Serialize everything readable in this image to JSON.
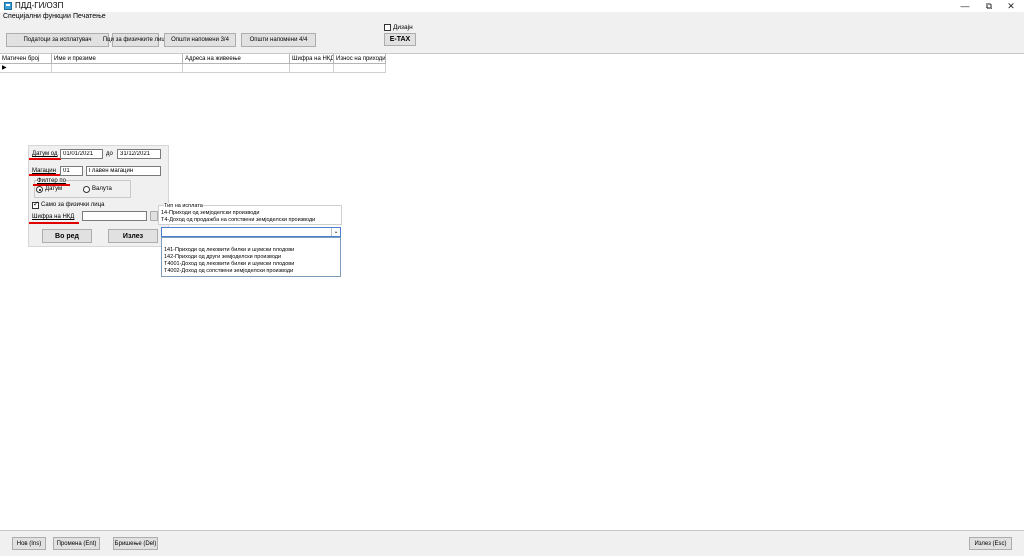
{
  "window": {
    "title": "ПДД-ГИ/ОЗП",
    "minimize": "—",
    "restore": "⧉",
    "close": "✕"
  },
  "menu": {
    "items": [
      "Специјални функции",
      "Печатење"
    ]
  },
  "toolbar": {
    "buttons": [
      "Податоци за исплатувач",
      "Пци за физичките лица",
      "Општи напомени 3/4",
      "Општи напомени 4/4"
    ],
    "design_checkbox": {
      "label": "Дизајн",
      "checked": false
    },
    "etax_label": "E-TAX"
  },
  "grid": {
    "columns": [
      "Матичен број",
      "Име и презиме",
      "Адреса на живеење",
      "Шифра на НКД",
      "Износ на приходи"
    ],
    "current_row_marker": "▶"
  },
  "filter": {
    "date_from_label": "Датум од",
    "date_from": "01/01/2021",
    "date_to_label": "до",
    "date_to": "31/12/2021",
    "warehouse_label": "Магацин",
    "warehouse_code": "01",
    "warehouse_name": "Главен магацин",
    "filter_by_label": "Филтер по",
    "filter_options": [
      "Датум",
      "Валута"
    ],
    "filter_selected": "Датум",
    "only_physical_label": "Само за физички лица",
    "only_physical_checked": true,
    "nkd_label": "Шифра на НКД",
    "nkd_value": "",
    "ok_label": "Во ред",
    "exit_label": "Излез"
  },
  "payment_type": {
    "title": "Тип на исплата",
    "header_lines": [
      "14-Приходи од земјоделски  производи",
      "Т4-Доход од продажба на сопствени земјоделски производи"
    ],
    "selected_value": "",
    "options": [
      "141-Приходи од лековити билки и шумски  плодови",
      "142-Приходи од други земјоделски производи",
      "Т4001-Доход од лековити билки и шумски плодови",
      "Т4002-Доход од сопствени земјоделски производи"
    ]
  },
  "statusbar": {
    "buttons": [
      "Нов (Ins)",
      "Промена (Ent)",
      "Бришење (Del)"
    ],
    "exit_label": "Излез (Esc)"
  },
  "colors": {
    "accent": "#4a7fd1",
    "underline_mark": "#e00000",
    "panel_bg": "#f0f0f0"
  }
}
